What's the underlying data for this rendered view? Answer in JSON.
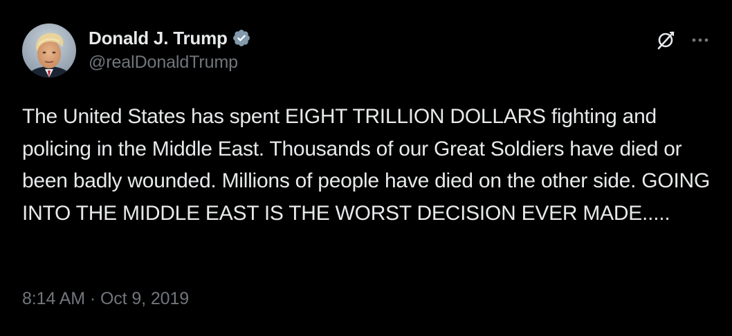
{
  "author": {
    "display_name": "Donald J. Trump",
    "handle": "@realDonaldTrump",
    "verified": true,
    "verified_color": "#829aab",
    "avatar_icon": "profile-photo"
  },
  "actions": {
    "grok_icon": "grok-icon",
    "more_icon": "more-options-icon"
  },
  "tweet": {
    "text": "The United States has spent EIGHT TRILLION DOLLARS fighting and policing in the Middle East. Thousands of our Great Soldiers have died or been badly wounded. Millions of people have died on the other side. GOING INTO THE MIDDLE EAST IS THE WORST DECISION EVER MADE.....",
    "timestamp": "8:14 AM · Oct 9, 2019"
  },
  "colors": {
    "background": "#000000",
    "primary_text": "#e7e9ea",
    "secondary_text": "#71767b"
  }
}
